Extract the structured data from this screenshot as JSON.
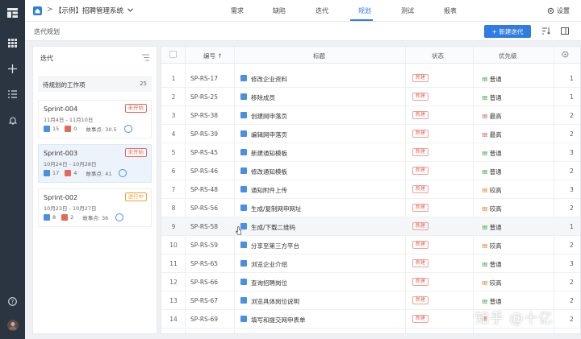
{
  "header": {
    "project": "【示例】招聘管理系统",
    "tabs": [
      {
        "label": "需求"
      },
      {
        "label": "缺陷"
      },
      {
        "label": "迭代"
      },
      {
        "label": "规划"
      },
      {
        "label": "测试"
      },
      {
        "label": "报表"
      }
    ],
    "active_tab": "规划",
    "settings": "设置"
  },
  "subbar": {
    "title": "迭代规划",
    "new_button": "+ 新建迭代"
  },
  "sprint_panel": {
    "title": "迭代",
    "backlog": {
      "label": "待规划的工作项",
      "count": "25"
    },
    "sprints": [
      {
        "name": "Sprint-004",
        "status": "未开始",
        "date": "11月4日 - 11月10日",
        "stories": "15",
        "bugs": "0",
        "points": "故事点: 30.5"
      },
      {
        "name": "Sprint-003",
        "status": "未开始",
        "date": "10月24日 - 10月28日",
        "stories": "17",
        "bugs": "4",
        "points": "故事点: 41"
      },
      {
        "name": "Sprint-002",
        "status": "进行中",
        "date": "10月23日 - 10月27日",
        "stories": "8",
        "bugs": "2",
        "points": "故事点: 36"
      }
    ]
  },
  "table": {
    "columns": {
      "code": "编号",
      "title": "标题",
      "status": "状态",
      "priority": "优先级"
    },
    "rows": [
      {
        "n": "1",
        "code": "SP-RS-17",
        "title": "修改企业资料",
        "status": "新建",
        "priority": "普通",
        "extra": "1"
      },
      {
        "n": "2",
        "code": "SP-RS-25",
        "title": "移除成员",
        "status": "新建",
        "priority": "普通",
        "extra": "1"
      },
      {
        "n": "3",
        "code": "SP-RS-38",
        "title": "创建网申落页",
        "status": "新建",
        "priority": "最高",
        "extra": "2"
      },
      {
        "n": "4",
        "code": "SP-RS-39",
        "title": "编辑网申落页",
        "status": "新建",
        "priority": "最高",
        "extra": "2"
      },
      {
        "n": "5",
        "code": "SP-RS-45",
        "title": "新建通知模板",
        "status": "新建",
        "priority": "普通",
        "extra": "3"
      },
      {
        "n": "6",
        "code": "SP-RS-46",
        "title": "修改通知模板",
        "status": "新建",
        "priority": "普通",
        "extra": "2"
      },
      {
        "n": "7",
        "code": "SP-RS-48",
        "title": "通知附件上传",
        "status": "新建",
        "priority": "较高",
        "extra": "3"
      },
      {
        "n": "8",
        "code": "SP-RS-56",
        "title": "生成/复制网申网址",
        "status": "新建",
        "priority": "较高",
        "extra": "2"
      },
      {
        "n": "9",
        "code": "SP-RS-58",
        "title": "生成/下载二维码",
        "status": "新建",
        "priority": "普通",
        "extra": "1"
      },
      {
        "n": "10",
        "code": "SP-RS-59",
        "title": "分享至第三方平台",
        "status": "新建",
        "priority": "较高",
        "extra": "2"
      },
      {
        "n": "11",
        "code": "SP-RS-65",
        "title": "浏览企业介绍",
        "status": "新建",
        "priority": "普通",
        "extra": "3"
      },
      {
        "n": "12",
        "code": "SP-RS-66",
        "title": "查询招聘岗位",
        "status": "新建",
        "priority": "较高",
        "extra": "2"
      },
      {
        "n": "13",
        "code": "SP-RS-67",
        "title": "浏览具体岗位说明",
        "status": "新建",
        "priority": "普通",
        "extra": "2"
      },
      {
        "n": "14",
        "code": "SP-RS-69",
        "title": "填写和提交网申表单",
        "status": "新建",
        "priority": "",
        "extra": "2"
      }
    ]
  },
  "watermark": "知乎 @十亿",
  "colors": {
    "accent": "#2f7de1",
    "rail": "#2b3441",
    "danger": "#e8665c",
    "warning": "#eba43a",
    "normal": "#4caf50",
    "high": "#e26a5c",
    "higher": "#eb8a3a"
  }
}
